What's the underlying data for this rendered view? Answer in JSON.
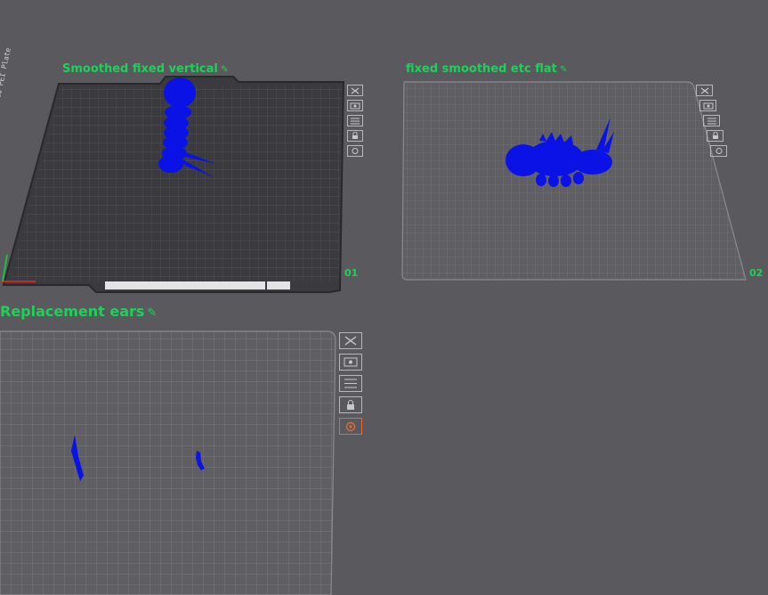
{
  "plates": [
    {
      "title": "Smoothed fixed vertical",
      "number": "01",
      "edit_icon": "pencil-icon",
      "bed_style": "textured-dark",
      "side_label": "BambuLab Textured PEI Plate"
    },
    {
      "title": "fixed smoothed etc flat",
      "number": "02",
      "edit_icon": "pencil-icon",
      "bed_style": "smooth-light"
    },
    {
      "title": "Replacement ears",
      "edit_icon": "pencil-icon",
      "bed_style": "smooth-light"
    }
  ],
  "toolbar_icons": [
    "close-icon",
    "auto-orient-icon",
    "arrange-icon",
    "lock-icon",
    "settings-icon"
  ],
  "colors": {
    "background": "#5a595e",
    "title_green": "#1fd05a",
    "model_blue": "#0a12e6",
    "grid_light": "#6a696e",
    "grid_dark": "#3b3b3f",
    "active_button": "#e06a3a"
  }
}
